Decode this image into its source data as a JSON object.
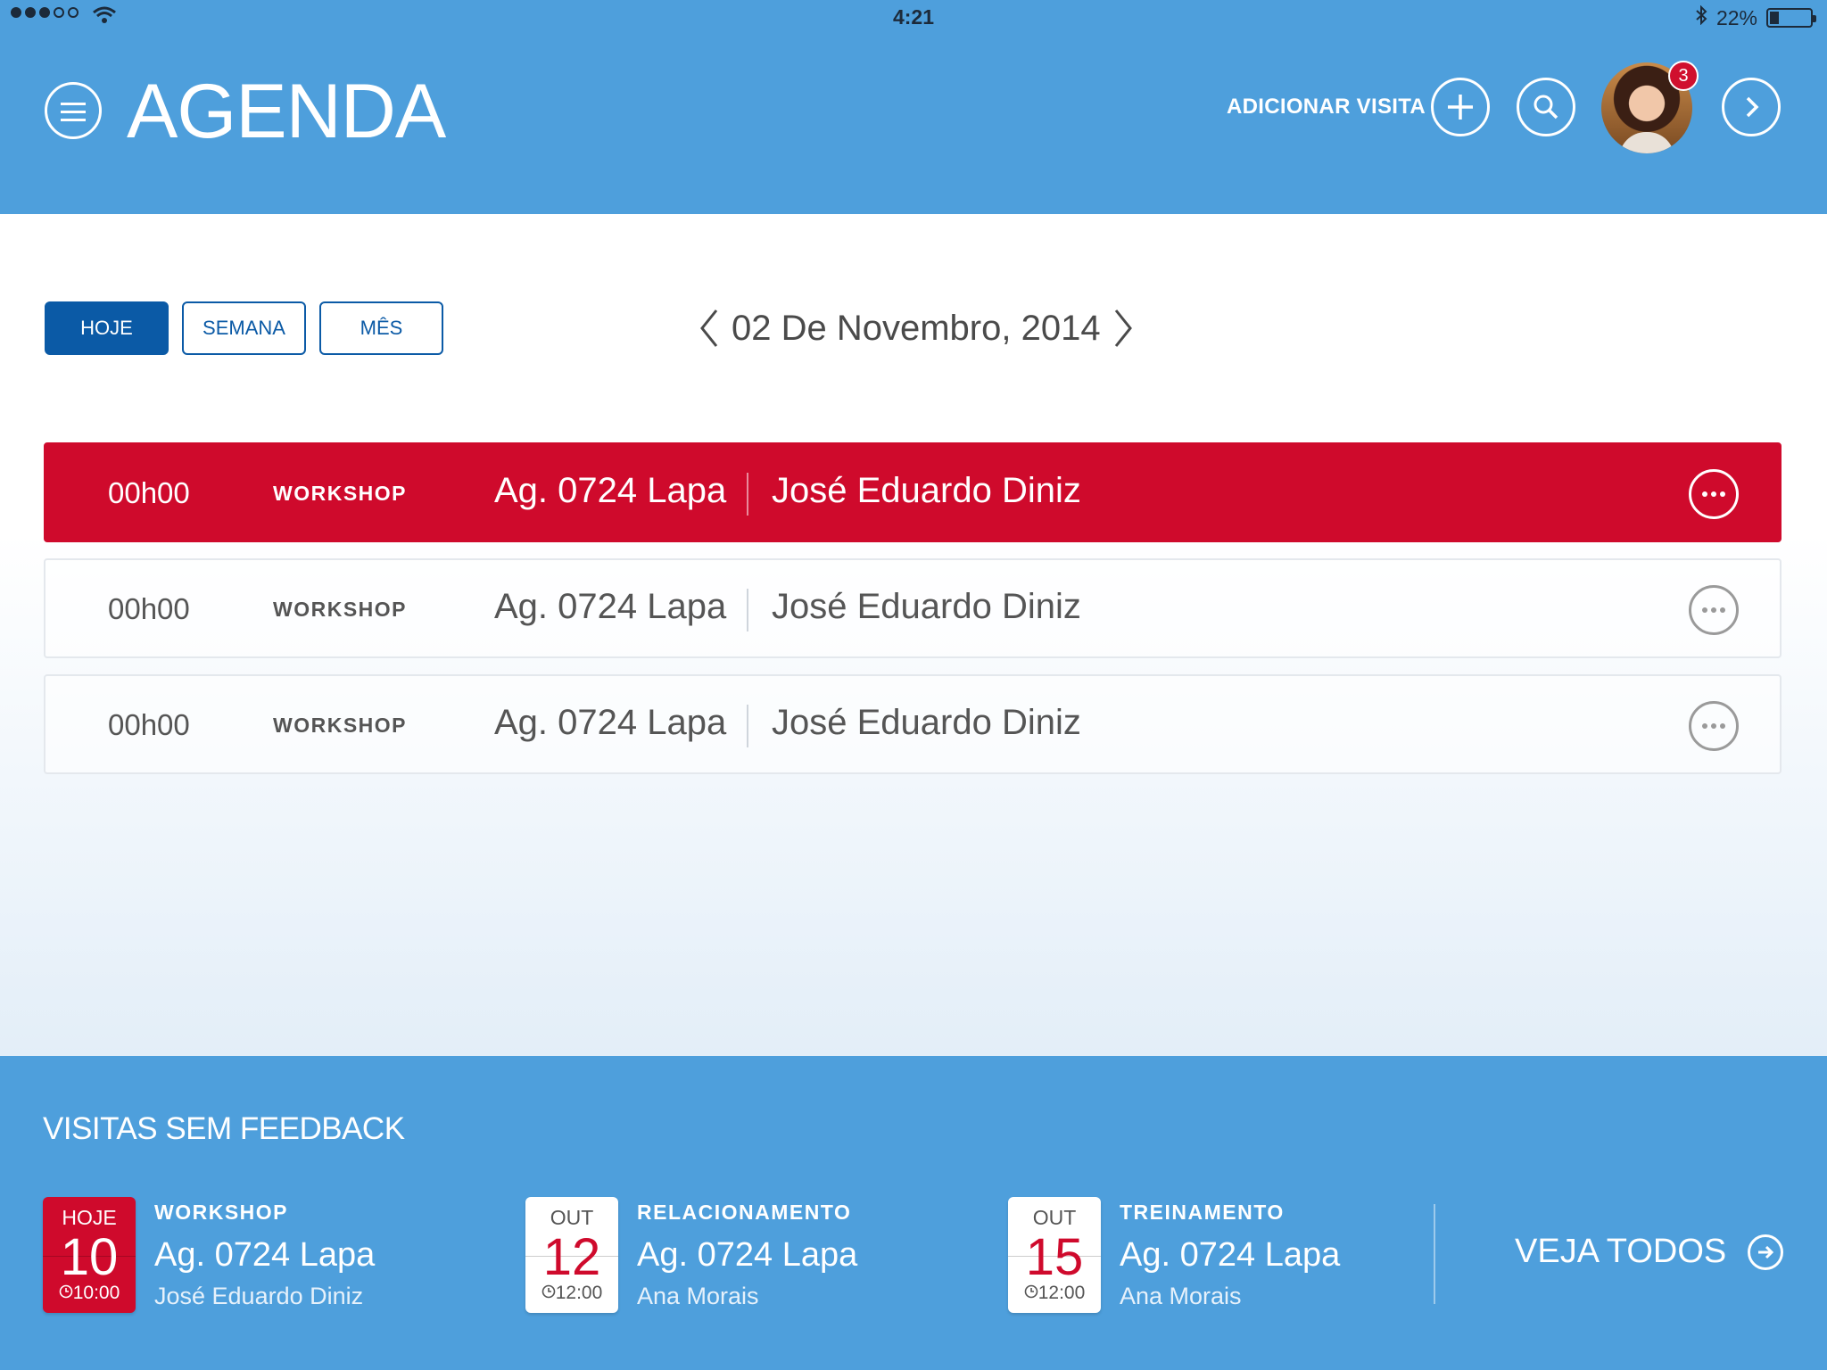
{
  "status_bar": {
    "time": "4:21",
    "battery": "22%",
    "battery_level": 0.22
  },
  "header": {
    "title": "AGENDA",
    "add_visit_label": "ADICIONAR VISITA",
    "notification_count": "3"
  },
  "tabs": [
    {
      "label": "HOJE",
      "active": true
    },
    {
      "label": "SEMANA",
      "active": false
    },
    {
      "label": "MÊS",
      "active": false
    }
  ],
  "date_label": "02 De Novembro, 2014",
  "appointments": [
    {
      "time": "00h00",
      "type": "WORKSHOP",
      "agency": "Ag. 0724 Lapa",
      "person": "José Eduardo Diniz",
      "highlighted": true
    },
    {
      "time": "00h00",
      "type": "WORKSHOP",
      "agency": "Ag. 0724 Lapa",
      "person": "José Eduardo Diniz",
      "highlighted": false
    },
    {
      "time": "00h00",
      "type": "WORKSHOP",
      "agency": "Ag. 0724 Lapa",
      "person": "José Eduardo Diniz",
      "highlighted": false
    }
  ],
  "feedback": {
    "title": "VISITAS SEM FEEDBACK",
    "items": [
      {
        "month": "HOJE",
        "day": "10",
        "hour": "10:00",
        "type": "WORKSHOP",
        "agency": "Ag. 0724 Lapa",
        "person": "José Eduardo Diniz",
        "today": true
      },
      {
        "month": "OUT",
        "day": "12",
        "hour": "12:00",
        "type": "RELACIONAMENTO",
        "agency": "Ag. 0724 Lapa",
        "person": "Ana Morais",
        "today": false
      },
      {
        "month": "OUT",
        "day": "15",
        "hour": "12:00",
        "type": "TREINAMENTO",
        "agency": "Ag. 0724 Lapa",
        "person": "Ana Morais",
        "today": false
      }
    ],
    "see_all_label": "VEJA TODOS"
  },
  "colors": {
    "header_blue": "#4e9fdc",
    "primary_blue": "#0b5aa6",
    "accent_red": "#cf0a2c"
  },
  "icons": [
    "menu-icon",
    "plus-icon",
    "search-icon",
    "chevron-right-icon",
    "chevron-left-icon",
    "more-icon",
    "clock-icon",
    "arrow-circle-right-icon"
  ]
}
